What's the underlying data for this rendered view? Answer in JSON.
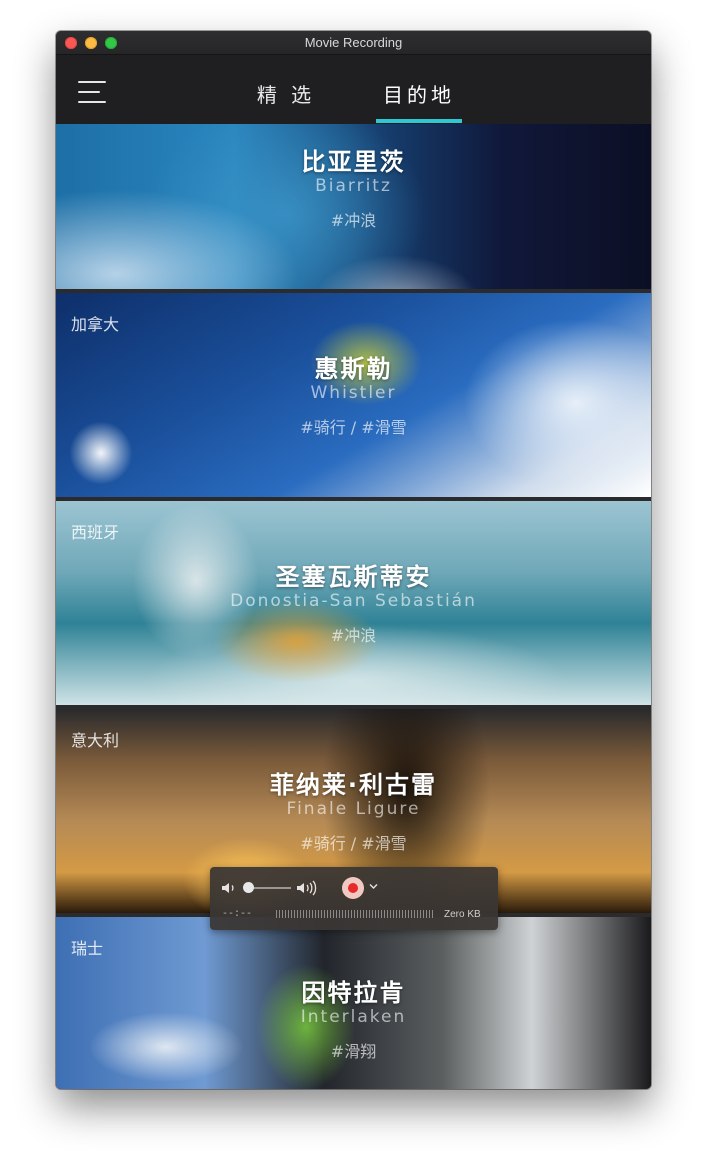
{
  "window": {
    "title": "Movie Recording"
  },
  "nav": {
    "tabs": [
      {
        "label": "精 选",
        "active": false
      },
      {
        "label": "目的地",
        "active": true
      }
    ],
    "accent_color": "#2ec7d3"
  },
  "destinations": [
    {
      "country": "",
      "name_cn": "比亚里茨",
      "name_en": "Biarritz",
      "tags": "#冲浪"
    },
    {
      "country": "加拿大",
      "name_cn": "惠斯勒",
      "name_en": "Whistler",
      "tags": "#骑行 / #滑雪"
    },
    {
      "country": "西班牙",
      "name_cn": "圣塞瓦斯蒂安",
      "name_en": "Donostia-San Sebastián",
      "tags": "#冲浪"
    },
    {
      "country": "意大利",
      "name_cn": "菲纳莱·利古雷",
      "name_en": "Finale Ligure",
      "tags": "#骑行 / #滑雪"
    },
    {
      "country": "瑞士",
      "name_cn": "因特拉肯",
      "name_en": "Interlaken",
      "tags": "#滑翔"
    }
  ],
  "recorder": {
    "time": "--:--",
    "file_size": "Zero KB",
    "volume_level": 0.0,
    "record_color": "#e8292a"
  }
}
